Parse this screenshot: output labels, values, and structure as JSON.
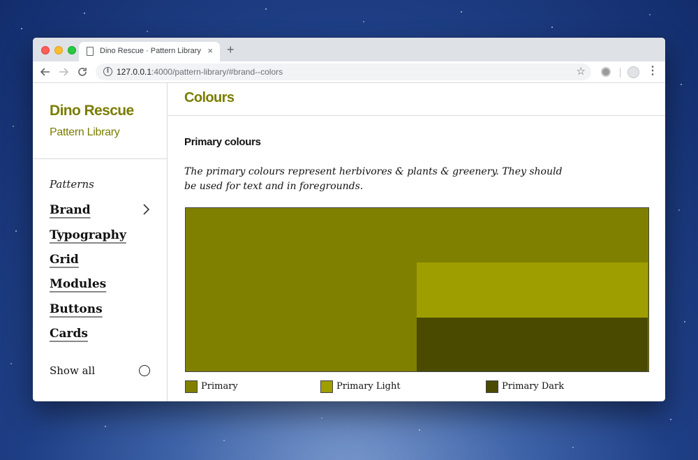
{
  "browser": {
    "tab_title": "Dino Rescue · Pattern Library",
    "tab_close": "×",
    "new_tab": "+",
    "url_host": "127.0.0.1",
    "url_path": ":4000/pattern-library/#brand--colors"
  },
  "sidebar": {
    "title": "Dino Rescue",
    "subtitle": "Pattern Library",
    "patterns_label": "Patterns",
    "items": [
      {
        "label": "Brand"
      },
      {
        "label": "Typography"
      },
      {
        "label": "Grid"
      },
      {
        "label": "Modules"
      },
      {
        "label": "Buttons"
      },
      {
        "label": "Cards"
      }
    ],
    "show_all": "Show all"
  },
  "main": {
    "title": "Colours",
    "section_title": "Primary colours",
    "description": "The primary colours represent herbivores & plants & greenery. They should be used for text and in foregrounds."
  },
  "swatches": [
    {
      "name": "Primary",
      "color": "#808000"
    },
    {
      "name": "Primary Light",
      "color": "#9e9e00"
    },
    {
      "name": "Primary Dark",
      "color": "#4a4a00"
    }
  ],
  "colors": {
    "accent": "#7a7d00"
  }
}
